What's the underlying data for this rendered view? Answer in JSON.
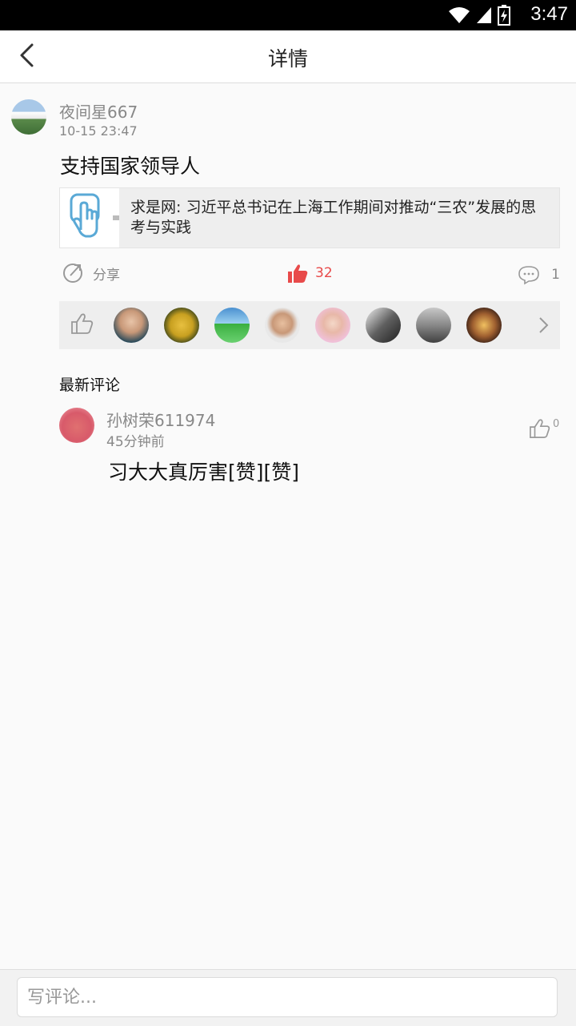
{
  "status_bar": {
    "time": "3:47",
    "icons": [
      "wifi-icon",
      "signal-icon",
      "battery-icon"
    ]
  },
  "header": {
    "title": "详情",
    "back_icon": "chevron-left-icon"
  },
  "post": {
    "username": "夜间星667",
    "time": "10-15 23:47",
    "text": "支持国家领导人",
    "link_card": {
      "title": "求是网: 习近平总书记在上海工作期间对推动“三农”发展的思考与实践"
    },
    "actions": {
      "share_label": "分享",
      "like_count": "32",
      "comment_count": "1"
    },
    "likers_count_shown": 8
  },
  "comments": {
    "section_title": "最新评论",
    "items": [
      {
        "username": "孙树荣611974",
        "time": "45分钟前",
        "text": "习大大真厉害[赞][赞]",
        "like_count": "0"
      }
    ]
  },
  "input": {
    "placeholder": "写评论..."
  },
  "colors": {
    "accent_red": "#e84a4a",
    "text_gray": "#888888",
    "background": "#fafafa"
  }
}
